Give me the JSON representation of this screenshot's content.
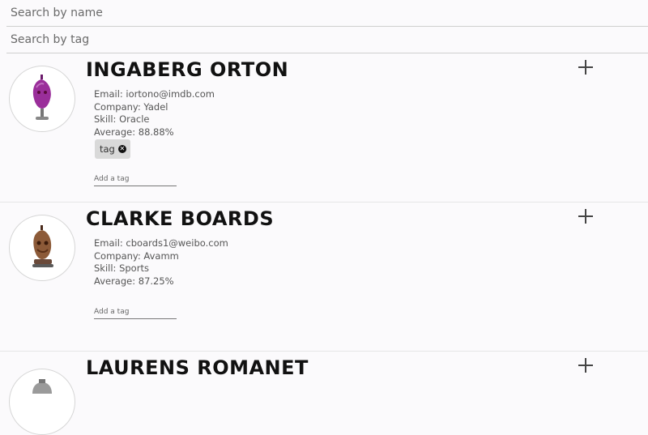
{
  "search": {
    "name_placeholder": "Search by name",
    "tag_placeholder": "Search by tag"
  },
  "students": [
    {
      "name": "INGABERG ORTON",
      "email": "Email: iortono@imdb.com",
      "company": "Company: Yadel",
      "skill": "Skill: Oracle",
      "average": "Average: 88.88%",
      "tags": [
        "tag"
      ],
      "add_tag_placeholder": "Add a tag",
      "avatar_color": "#8a1f8a",
      "expand_icon": "plus-icon"
    },
    {
      "name": "CLARKE BOARDS",
      "email": "Email: cboards1@weibo.com",
      "company": "Company: Avamm",
      "skill": "Skill: Sports",
      "average": "Average: 87.25%",
      "tags": [],
      "add_tag_placeholder": "Add a tag",
      "avatar_color": "#8a5a3a",
      "expand_icon": "plus-icon"
    },
    {
      "name": "LAURENS ROMANET",
      "avatar_color": "#8a8a8a",
      "expand_icon": "plus-icon"
    }
  ],
  "tag_remove_icon": "close-circle-icon"
}
